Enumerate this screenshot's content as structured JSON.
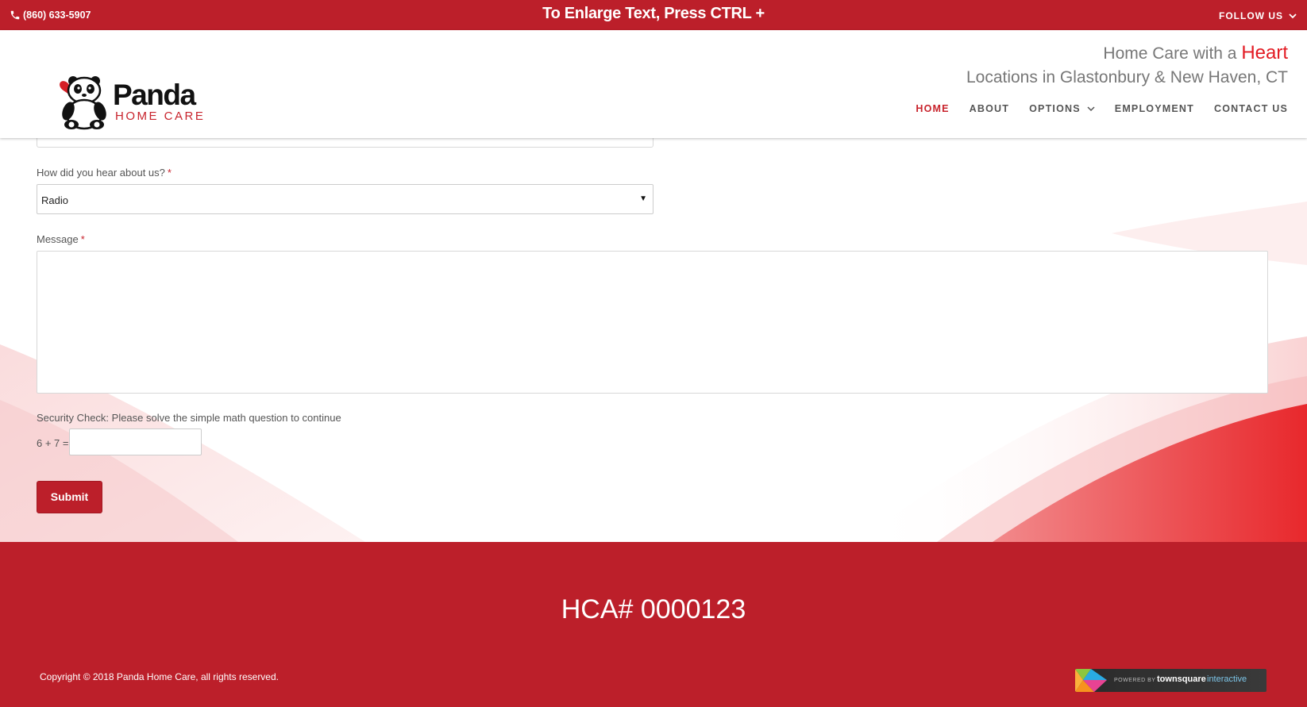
{
  "topbar": {
    "phone": "(860) 633-5907",
    "notice": "To Enlarge Text, Press CTRL +",
    "follow": "FOLLOW US"
  },
  "header": {
    "logo_name": "Panda",
    "logo_sub": "HOME CARE",
    "tagline_prefix": "Home Care with a",
    "tagline_heart": "Heart",
    "locations": "Locations in Glastonbury & New Haven, CT",
    "nav": [
      {
        "label": "HOME",
        "active": true
      },
      {
        "label": "ABOUT"
      },
      {
        "label": "OPTIONS"
      },
      {
        "label": "EMPLOYMENT"
      },
      {
        "label": "CONTACT US"
      }
    ]
  },
  "form": {
    "hear_label": "How did you hear about us?",
    "hear_value": "Radio",
    "message_label": "Message",
    "required_mark": "*",
    "security_label": "Security Check: Please solve the simple math question to continue",
    "math_question": "6 + 7 =",
    "submit_label": "Submit"
  },
  "footer": {
    "hca": "HCA# 0000123",
    "copyright": "Copyright © 2018 Panda Home Care, all rights reserved.",
    "badge_powered": "POWERED BY",
    "badge_brand": "townsquare",
    "badge_brand2": "interactive"
  },
  "colors": {
    "brand_red": "#bc1f2a",
    "heart_red": "#e31b23"
  }
}
